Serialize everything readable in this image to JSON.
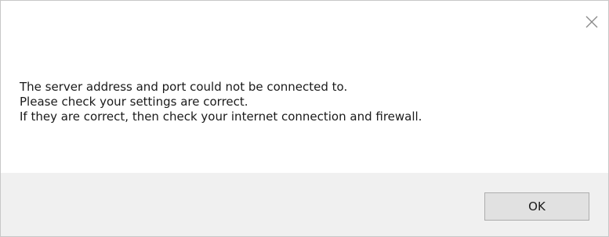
{
  "dialog": {
    "close_icon": "close-icon",
    "message_lines": [
      "The server address and port could not be connected to.",
      "Please check your settings are correct.",
      "If they are correct, then check your internet connection and firewall."
    ],
    "ok_label": "OK"
  },
  "colors": {
    "footer_background": "#f0f0f0",
    "button_background": "#e1e1e1",
    "button_border": "#adadad"
  }
}
